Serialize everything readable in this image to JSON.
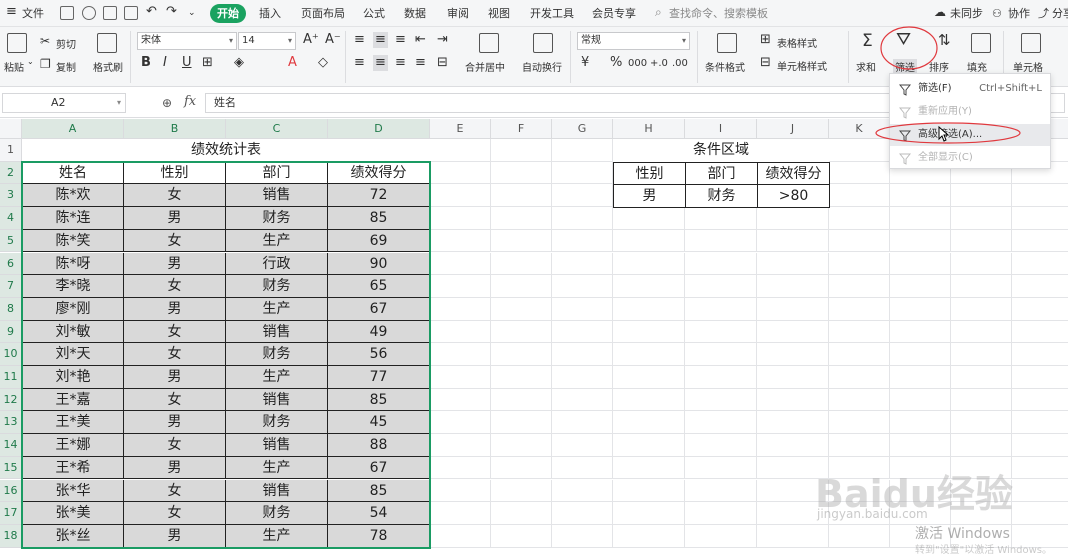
{
  "menubar": {
    "hamburger": "文件",
    "tabs": [
      "插入",
      "页面布局",
      "公式",
      "数据",
      "审阅",
      "视图",
      "开发工具",
      "会员专享"
    ],
    "active_tab": "开始",
    "search": "查找命令、搜索模板",
    "sync": "未同步",
    "collab": "协作",
    "share": "分享"
  },
  "toolbar": {
    "paste": "粘贴",
    "cut": "剪切",
    "copy": "复制",
    "format_painter": "格式刷",
    "font_name": "宋体",
    "font_size": "14",
    "merge": "合并居中",
    "wrap": "自动换行",
    "number_format": "常规",
    "cond_format": "条件格式",
    "table_style": "表格样式",
    "cell_style": "单元格样式",
    "sum": "求和",
    "filter": "筛选",
    "sort": "排序",
    "fill": "填充",
    "cell": "单元格",
    "currency": "¥",
    "percent": "%",
    "thousands": "000",
    "inc_dec": "+.0",
    "dec_dec": ".00"
  },
  "formula": {
    "cell_ref": "A2",
    "zoom_icon": "magnifier-icon",
    "fx": "fx",
    "value": "姓名"
  },
  "columns": [
    "A",
    "B",
    "C",
    "D",
    "E",
    "F",
    "G",
    "H",
    "I",
    "J",
    "K"
  ],
  "rows": [
    "1",
    "2",
    "3",
    "4",
    "5",
    "6",
    "7",
    "8",
    "9",
    "10",
    "11",
    "12",
    "13",
    "14",
    "15",
    "16",
    "17",
    "18"
  ],
  "sheet": {
    "title": "绩效统计表",
    "headers": [
      "姓名",
      "性别",
      "部门",
      "绩效得分"
    ],
    "data": [
      [
        "陈*欢",
        "女",
        "销售",
        "72"
      ],
      [
        "陈*连",
        "男",
        "财务",
        "85"
      ],
      [
        "陈*笑",
        "女",
        "生产",
        "69"
      ],
      [
        "陈*呀",
        "男",
        "行政",
        "90"
      ],
      [
        "李*晓",
        "女",
        "财务",
        "65"
      ],
      [
        "廖*刚",
        "男",
        "生产",
        "67"
      ],
      [
        "刘*敏",
        "女",
        "销售",
        "49"
      ],
      [
        "刘*天",
        "女",
        "财务",
        "56"
      ],
      [
        "刘*艳",
        "男",
        "生产",
        "77"
      ],
      [
        "王*嘉",
        "女",
        "销售",
        "85"
      ],
      [
        "王*美",
        "男",
        "财务",
        "45"
      ],
      [
        "王*娜",
        "女",
        "销售",
        "88"
      ],
      [
        "王*希",
        "男",
        "生产",
        "67"
      ],
      [
        "张*华",
        "女",
        "销售",
        "85"
      ],
      [
        "张*美",
        "女",
        "财务",
        "54"
      ],
      [
        "张*丝",
        "男",
        "生产",
        "78"
      ]
    ]
  },
  "criteria": {
    "title": "条件区域",
    "headers": [
      "性别",
      "部门",
      "绩效得分"
    ],
    "values": [
      "男",
      "财务",
      ">80"
    ]
  },
  "filter_menu": {
    "items": [
      {
        "label": "筛选(F)",
        "shortcut": "Ctrl+Shift+L",
        "disabled": false
      },
      {
        "label": "重新应用(Y)",
        "shortcut": "",
        "disabled": true
      },
      {
        "label": "高级筛选(A)...",
        "shortcut": "",
        "disabled": false
      },
      {
        "label": "全部显示(C)",
        "shortcut": "",
        "disabled": true
      }
    ]
  },
  "watermark": {
    "brand": "Baidu经验",
    "url": "jingyan.baidu.com",
    "activate": "激活 Windows",
    "activate_sub": "转到\"设置\"以激活 Windows。"
  },
  "colors": {
    "accent": "#1aa260",
    "selection": "#1a9b63",
    "annotation": "#e0393e",
    "data_fill": "#d9d9d9"
  }
}
